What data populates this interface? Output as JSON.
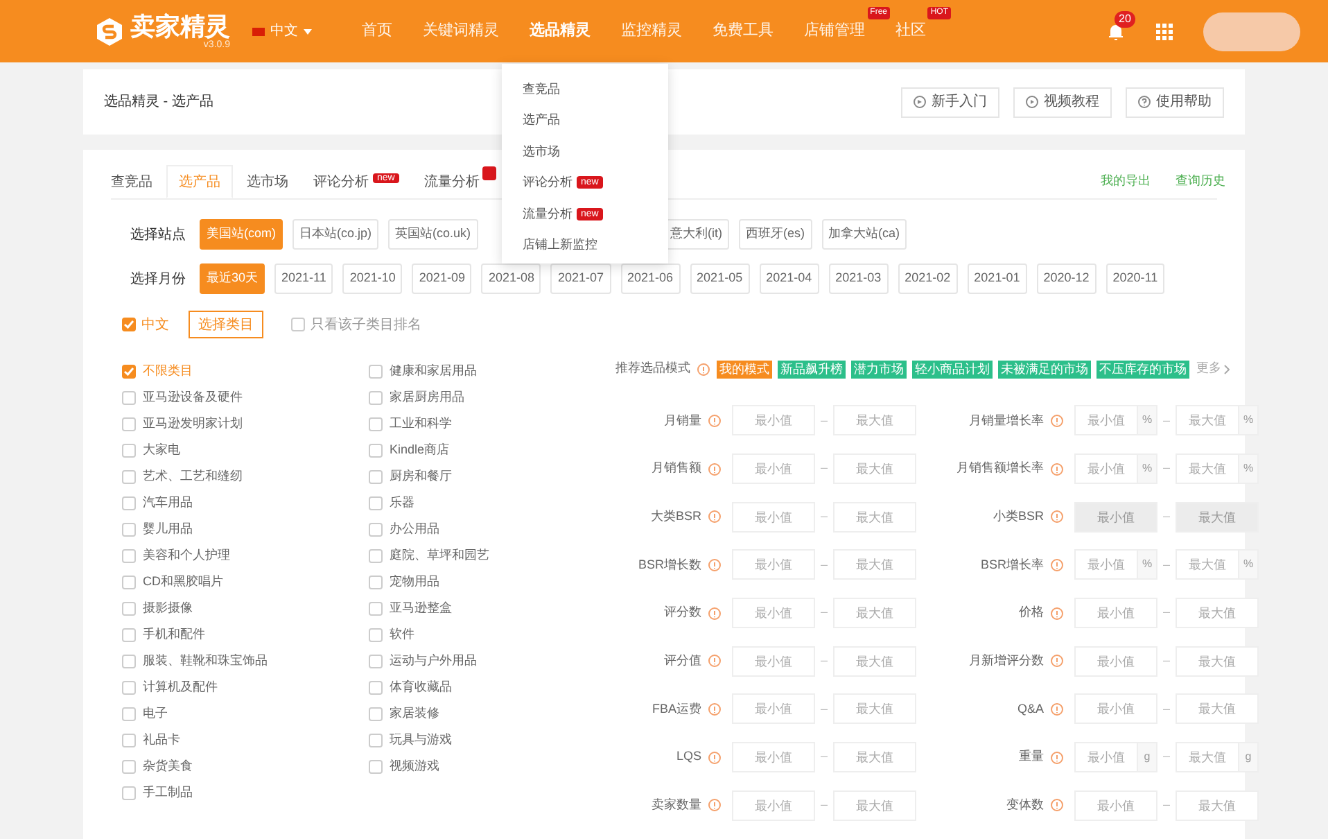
{
  "logo": {
    "name": "卖家精灵",
    "version": "v3.0.9"
  },
  "language": "中文",
  "nav": [
    {
      "label": "首页",
      "selected": false
    },
    {
      "label": "关键词精灵",
      "selected": false
    },
    {
      "label": "选品精灵",
      "selected": true
    },
    {
      "label": "监控精灵",
      "selected": false
    },
    {
      "label": "免费工具",
      "selected": false
    },
    {
      "label": "店铺管理",
      "selected": false,
      "badge": "Free"
    },
    {
      "label": "社区",
      "selected": false,
      "badge": "HOT"
    }
  ],
  "notifications": "20",
  "breadcrumb": "选品精灵 - 选产品",
  "help_buttons": [
    "新手入门",
    "视频教程",
    "使用帮助"
  ],
  "dropdown": [
    {
      "label": "查竞品"
    },
    {
      "label": "选产品"
    },
    {
      "label": "选市场"
    },
    {
      "label": "评论分析",
      "badge": "new"
    },
    {
      "label": "流量分析",
      "badge": "new"
    },
    {
      "label": "店铺上新监控"
    }
  ],
  "tabs": [
    {
      "label": "查竞品",
      "selected": false
    },
    {
      "label": "选产品",
      "selected": true
    },
    {
      "label": "选市场",
      "selected": false
    },
    {
      "label": "评论分析",
      "selected": false,
      "badge": "new"
    },
    {
      "label": "流量分析",
      "selected": false
    }
  ],
  "links": [
    "我的导出",
    "查询历史"
  ],
  "site": {
    "label": "选择站点",
    "options": [
      {
        "label": "美国站(com)",
        "selected": true
      },
      {
        "label": "日本站(co.jp)",
        "selected": false
      },
      {
        "label": "英国站(co.uk)",
        "selected": false
      },
      {
        "label": "意大利(it)",
        "selected": false
      },
      {
        "label": "西班牙(es)",
        "selected": false
      },
      {
        "label": "加拿大站(ca)",
        "selected": false
      }
    ]
  },
  "month": {
    "label": "选择月份",
    "options": [
      {
        "label": "最近30天",
        "selected": true
      },
      {
        "label": "2021-11",
        "selected": false
      },
      {
        "label": "2021-10",
        "selected": false
      },
      {
        "label": "2021-09",
        "selected": false
      },
      {
        "label": "2021-08",
        "selected": false
      },
      {
        "label": "2021-07",
        "selected": false
      },
      {
        "label": "2021-06",
        "selected": false
      },
      {
        "label": "2021-05",
        "selected": false
      },
      {
        "label": "2021-04",
        "selected": false
      },
      {
        "label": "2021-03",
        "selected": false
      },
      {
        "label": "2021-02",
        "selected": false
      },
      {
        "label": "2021-01",
        "selected": false
      },
      {
        "label": "2020-12",
        "selected": false
      },
      {
        "label": "2020-11",
        "selected": false
      }
    ]
  },
  "chinese": {
    "label": "中文",
    "checked": true
  },
  "category_button": "选择类目",
  "subcategory_only": {
    "label": "只看该子类目排名",
    "checked": false
  },
  "category_columns": [
    {
      "items": [
        {
          "label": "不限类目",
          "checked": true
        },
        {
          "label": "亚马逊设备及硬件",
          "checked": false
        },
        {
          "label": "亚马逊发明家计划",
          "checked": false
        },
        {
          "label": "大家电",
          "checked": false
        },
        {
          "label": "艺术、工艺和缝纫",
          "checked": false
        },
        {
          "label": "汽车用品",
          "checked": false
        },
        {
          "label": "婴儿用品",
          "checked": false
        },
        {
          "label": "美容和个人护理",
          "checked": false
        },
        {
          "label": "CD和黑胶唱片",
          "checked": false
        },
        {
          "label": "摄影摄像",
          "checked": false
        },
        {
          "label": "手机和配件",
          "checked": false
        },
        {
          "label": "服装、鞋靴和珠宝饰品",
          "checked": false
        },
        {
          "label": "计算机及配件",
          "checked": false
        },
        {
          "label": "电子",
          "checked": false
        },
        {
          "label": "礼品卡",
          "checked": false
        },
        {
          "label": "杂货美食",
          "checked": false
        },
        {
          "label": "手工制品",
          "checked": false
        }
      ]
    },
    {
      "items": [
        {
          "label": "健康和家居用品",
          "checked": false
        },
        {
          "label": "家居厨房用品",
          "checked": false
        },
        {
          "label": "工业和科学",
          "checked": false
        },
        {
          "label": "Kindle商店",
          "checked": false
        },
        {
          "label": "厨房和餐厅",
          "checked": false
        },
        {
          "label": "乐器",
          "checked": false
        },
        {
          "label": "办公用品",
          "checked": false
        },
        {
          "label": "庭院、草坪和园艺",
          "checked": false
        },
        {
          "label": "宠物用品",
          "checked": false
        },
        {
          "label": "亚马逊整盒",
          "checked": false
        },
        {
          "label": "软件",
          "checked": false
        },
        {
          "label": "运动与户外用品",
          "checked": false
        },
        {
          "label": "体育收藏品",
          "checked": false
        },
        {
          "label": "家居装修",
          "checked": false
        },
        {
          "label": "玩具与游戏",
          "checked": false
        },
        {
          "label": "视频游戏",
          "checked": false
        }
      ]
    }
  ],
  "modes": {
    "label": "推荐选品模式",
    "more": "更多",
    "items": [
      {
        "label": "我的模式",
        "selected": true
      },
      {
        "label": "新品飙升榜",
        "selected": false
      },
      {
        "label": "潜力市场",
        "selected": false
      },
      {
        "label": "轻小商品计划",
        "selected": false
      },
      {
        "label": "未被满足的市场",
        "selected": false
      },
      {
        "label": "不压库存的市场",
        "selected": false
      }
    ]
  },
  "filter_rows": [
    {
      "left": {
        "label": "月销量",
        "dash": "–",
        "inputs": [
          {
            "placeholder": "最小值",
            "disabled": false
          },
          {
            "placeholder": "最大值",
            "disabled": false
          }
        ]
      },
      "right": {
        "label": "月销量增长率",
        "dash": "–",
        "inputs": [
          {
            "placeholder": "最小值",
            "unit": "%",
            "disabled": false
          },
          {
            "placeholder": "最大值",
            "unit": "%",
            "disabled": false
          }
        ]
      }
    },
    {
      "left": {
        "label": "月销售额",
        "dash": "–",
        "inputs": [
          {
            "placeholder": "最小值",
            "disabled": false
          },
          {
            "placeholder": "最大值",
            "disabled": false
          }
        ]
      },
      "right": {
        "label": "月销售额增长率",
        "dash": "–",
        "inputs": [
          {
            "placeholder": "最小值",
            "unit": "%",
            "disabled": false
          },
          {
            "placeholder": "最大值",
            "unit": "%",
            "disabled": false
          }
        ]
      }
    },
    {
      "left": {
        "label": "大类BSR",
        "dash": "–",
        "inputs": [
          {
            "placeholder": "最小值",
            "disabled": false
          },
          {
            "placeholder": "最大值",
            "disabled": false
          }
        ]
      },
      "right": {
        "label": "小类BSR",
        "dash": "–",
        "inputs": [
          {
            "placeholder": "最小值",
            "disabled": true
          },
          {
            "placeholder": "最大值",
            "disabled": true
          }
        ]
      }
    },
    {
      "left": {
        "label": "BSR增长数",
        "dash": "–",
        "inputs": [
          {
            "placeholder": "最小值",
            "disabled": false
          },
          {
            "placeholder": "最大值",
            "disabled": false
          }
        ]
      },
      "right": {
        "label": "BSR增长率",
        "dash": "–",
        "inputs": [
          {
            "placeholder": "最小值",
            "unit": "%",
            "disabled": false
          },
          {
            "placeholder": "最大值",
            "unit": "%",
            "disabled": false
          }
        ]
      }
    },
    {
      "left": {
        "label": "评分数",
        "dash": "–",
        "inputs": [
          {
            "placeholder": "最小值",
            "disabled": false
          },
          {
            "placeholder": "最大值",
            "disabled": false
          }
        ]
      },
      "right": {
        "label": "价格",
        "dash": "–",
        "inputs": [
          {
            "placeholder": "最小值",
            "disabled": false
          },
          {
            "placeholder": "最大值",
            "disabled": false
          }
        ]
      }
    },
    {
      "left": {
        "label": "评分值",
        "dash": "–",
        "inputs": [
          {
            "placeholder": "最小值",
            "disabled": false
          },
          {
            "placeholder": "最大值",
            "disabled": false
          }
        ]
      },
      "right": {
        "label": "月新增评分数",
        "dash": "–",
        "inputs": [
          {
            "placeholder": "最小值",
            "disabled": false
          },
          {
            "placeholder": "最大值",
            "disabled": false
          }
        ]
      }
    },
    {
      "left": {
        "label": "FBA运费",
        "dash": "–",
        "inputs": [
          {
            "placeholder": "最小值",
            "disabled": false
          },
          {
            "placeholder": "最大值",
            "disabled": false
          }
        ]
      },
      "right": {
        "label": "Q&A",
        "dash": "–",
        "inputs": [
          {
            "placeholder": "最小值",
            "disabled": false
          },
          {
            "placeholder": "最大值",
            "disabled": false
          }
        ]
      }
    },
    {
      "left": {
        "label": "LQS",
        "dash": "–",
        "inputs": [
          {
            "placeholder": "最小值",
            "disabled": false
          },
          {
            "placeholder": "最大值",
            "disabled": false
          }
        ]
      },
      "right": {
        "label": "重量",
        "dash": "–",
        "inputs": [
          {
            "placeholder": "最小值",
            "unit": "g",
            "disabled": false
          },
          {
            "placeholder": "最大值",
            "unit": "g",
            "disabled": false
          }
        ]
      }
    },
    {
      "left": {
        "label": "卖家数量",
        "dash": "–",
        "inputs": [
          {
            "placeholder": "最小值",
            "disabled": false
          },
          {
            "placeholder": "最大值",
            "disabled": false
          }
        ]
      },
      "right": {
        "label": "变体数",
        "dash": "–",
        "inputs": [
          {
            "placeholder": "最小值",
            "disabled": false
          },
          {
            "placeholder": "最大值",
            "disabled": false
          }
        ]
      }
    }
  ]
}
